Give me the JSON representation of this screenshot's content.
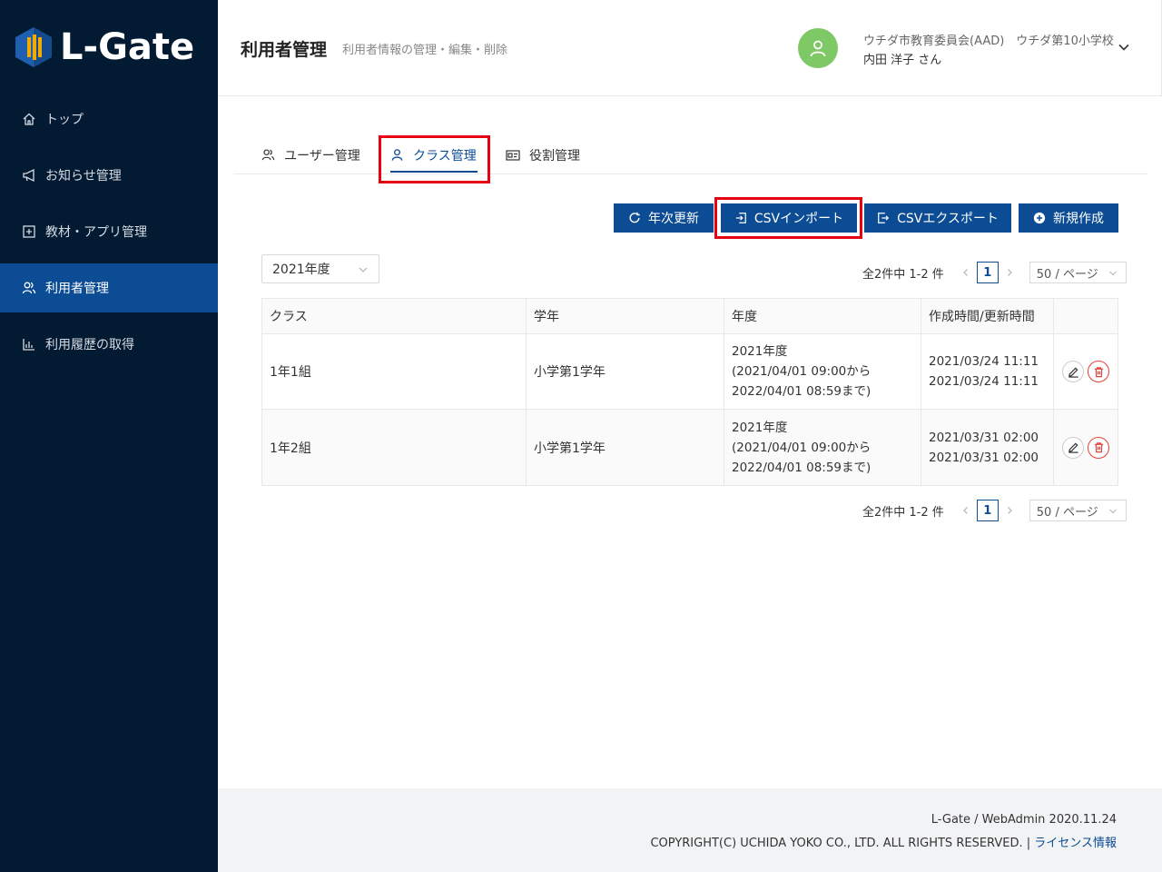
{
  "brand": {
    "name": "L-Gate"
  },
  "sidebar": {
    "items": [
      {
        "label": "トップ",
        "icon": "home-icon"
      },
      {
        "label": "お知らせ管理",
        "icon": "megaphone-icon"
      },
      {
        "label": "教材・アプリ管理",
        "icon": "plus-square-icon"
      },
      {
        "label": "利用者管理",
        "icon": "users-icon",
        "active": true
      },
      {
        "label": "利用履歴の取得",
        "icon": "bar-chart-icon"
      }
    ]
  },
  "header": {
    "title": "利用者管理",
    "subtitle": "利用者情報の管理・編集・削除",
    "user_org": "ウチダ市教育委員会(AAD)　ウチダ第10小学校",
    "user_name": "内田 洋子 さん"
  },
  "tabs": [
    {
      "label": "ユーザー管理",
      "icon": "users-icon"
    },
    {
      "label": "クラス管理",
      "icon": "user-icon",
      "active": true
    },
    {
      "label": "役割管理",
      "icon": "id-card-icon"
    }
  ],
  "toolbar": {
    "annual_update_label": "年次更新",
    "csv_import_label": "CSVインポート",
    "csv_export_label": "CSVエクスポート",
    "new_label": "新規作成"
  },
  "filter": {
    "year_value": "2021年度"
  },
  "pagination": {
    "total_text": "全2件中 1-2 件",
    "current_page": "1",
    "page_size": "50 / ページ"
  },
  "table": {
    "headers": [
      "クラス",
      "学年",
      "年度",
      "作成時間/更新時間",
      ""
    ],
    "rows": [
      {
        "class": "1年1組",
        "grade": "小学第1学年",
        "year": [
          "2021年度",
          "(2021/04/01 09:00から",
          "2022/04/01 08:59まで)"
        ],
        "times": [
          "2021/03/24 11:11",
          "2021/03/24 11:11"
        ]
      },
      {
        "class": "1年2組",
        "grade": "小学第1学年",
        "year": [
          "2021年度",
          "(2021/04/01 09:00から",
          "2022/04/01 08:59まで)"
        ],
        "times": [
          "2021/03/31 02:00",
          "2021/03/31 02:00"
        ]
      }
    ]
  },
  "footer": {
    "version": "L-Gate / WebAdmin 2020.11.24",
    "copyright": "COPYRIGHT(C) UCHIDA YOKO CO., LTD. ALL RIGHTS RESERVED. | ",
    "license_link": "ライセンス情報"
  },
  "colors": {
    "sidebar_bg": "#031a33",
    "primary": "#0b4c94",
    "highlight": "#e60012",
    "avatar": "#7ec865",
    "delete": "#e0413a"
  }
}
